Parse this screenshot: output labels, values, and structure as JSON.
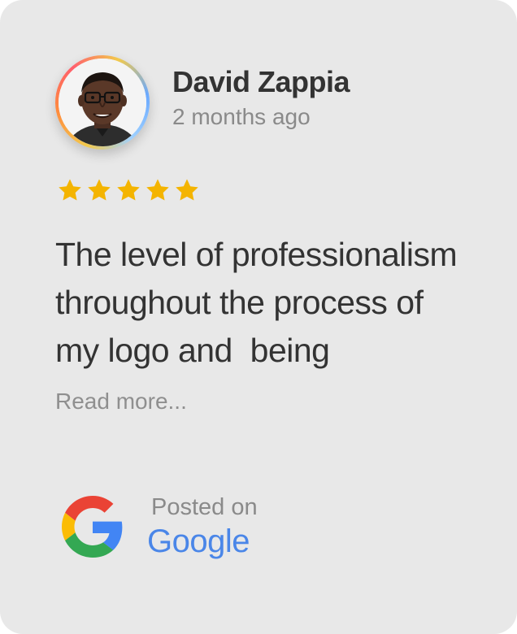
{
  "review": {
    "reviewer_name": "David Zappia",
    "time_ago": "2 months ago",
    "rating": 5,
    "rating_max": 5,
    "star_color": "#F4B400",
    "text_lines": [
      "The level of professionalism",
      "throughout the process of",
      "my logo and  being"
    ],
    "read_more": "Read more...",
    "avatar_icon": "reviewer-avatar-photo"
  },
  "source": {
    "posted_label": "Posted on",
    "platform": "Google",
    "platform_color": "#4A86E8",
    "logo_icon": "google-g-icon"
  }
}
